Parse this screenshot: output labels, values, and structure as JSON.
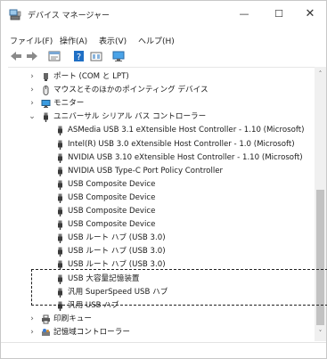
{
  "window": {
    "title": "デバイス マネージャー",
    "minimize_glyph": "—",
    "maximize_glyph": "☐",
    "close_glyph": "✕"
  },
  "menu": {
    "items": [
      {
        "label": "ファイル(F)"
      },
      {
        "label": "操作(A)"
      },
      {
        "label": "表示(V)"
      },
      {
        "label": "ヘルプ(H)"
      }
    ]
  },
  "toolbar": {
    "buttons": [
      {
        "icon": "back-arrow-icon"
      },
      {
        "icon": "forward-arrow-icon"
      },
      {
        "icon": "properties-icon"
      },
      {
        "icon": "help-icon"
      },
      {
        "icon": "update-driver-icon"
      },
      {
        "icon": "monitor-icon"
      }
    ]
  },
  "tree": {
    "items": [
      {
        "label": "ポート (COM と LPT)",
        "icon": "port-icon",
        "expander": "›",
        "level": 0
      },
      {
        "label": "マウスとそのほかのポインティング デバイス",
        "icon": "mouse-icon",
        "expander": "›",
        "level": 0
      },
      {
        "label": "モニター",
        "icon": "monitor-icon",
        "expander": "›",
        "level": 0
      },
      {
        "label": "ユニバーサル シリアル バス コントローラー",
        "icon": "usb-icon",
        "expander": "⌄",
        "level": 0
      },
      {
        "label": "ASMedia USB 3.1 eXtensible Host Controller - 1.10 (Microsoft)",
        "icon": "usb-icon",
        "level": 1
      },
      {
        "label": "Intel(R) USB 3.0 eXtensible Host Controller - 1.0 (Microsoft)",
        "icon": "usb-icon",
        "level": 1
      },
      {
        "label": "NVIDIA USB 3.10 eXtensible Host Controller - 1.10 (Microsoft)",
        "icon": "usb-icon",
        "level": 1
      },
      {
        "label": "NVIDIA USB Type-C Port Policy Controller",
        "icon": "usb-icon",
        "level": 1
      },
      {
        "label": "USB Composite Device",
        "icon": "usb-icon",
        "level": 1
      },
      {
        "label": "USB Composite Device",
        "icon": "usb-icon",
        "level": 1
      },
      {
        "label": "USB Composite Device",
        "icon": "usb-icon",
        "level": 1
      },
      {
        "label": "USB Composite Device",
        "icon": "usb-icon",
        "level": 1
      },
      {
        "label": "USB ルート ハブ (USB 3.0)",
        "icon": "usb-icon",
        "level": 1
      },
      {
        "label": "USB ルート ハブ (USB 3.0)",
        "icon": "usb-icon",
        "level": 1
      },
      {
        "label": "USB ルート ハブ (USB 3.0)",
        "icon": "usb-icon",
        "level": 1
      },
      {
        "label": "USB 大容量記憶装置",
        "icon": "usb-icon",
        "level": 1
      },
      {
        "label": "汎用 SuperSpeed USB ハブ",
        "icon": "usb-icon",
        "level": 1
      },
      {
        "label": "汎用 USB ハブ",
        "icon": "usb-icon",
        "level": 1
      },
      {
        "label": "印刷キュー",
        "icon": "printer-icon",
        "expander": "›",
        "level": 0
      },
      {
        "label": "記憶域コントローラー",
        "icon": "storage-controller-icon",
        "expander": "›",
        "level": 0
      }
    ]
  },
  "scrollbar": {
    "up_glyph": "˄",
    "down_glyph": "˅"
  },
  "colors": {
    "usb_icon": "#3a3a3a",
    "monitor_icon": "#2e8bd6",
    "help_icon": "#1f6fc5",
    "scroll_thumb": "#c2c2c2"
  }
}
